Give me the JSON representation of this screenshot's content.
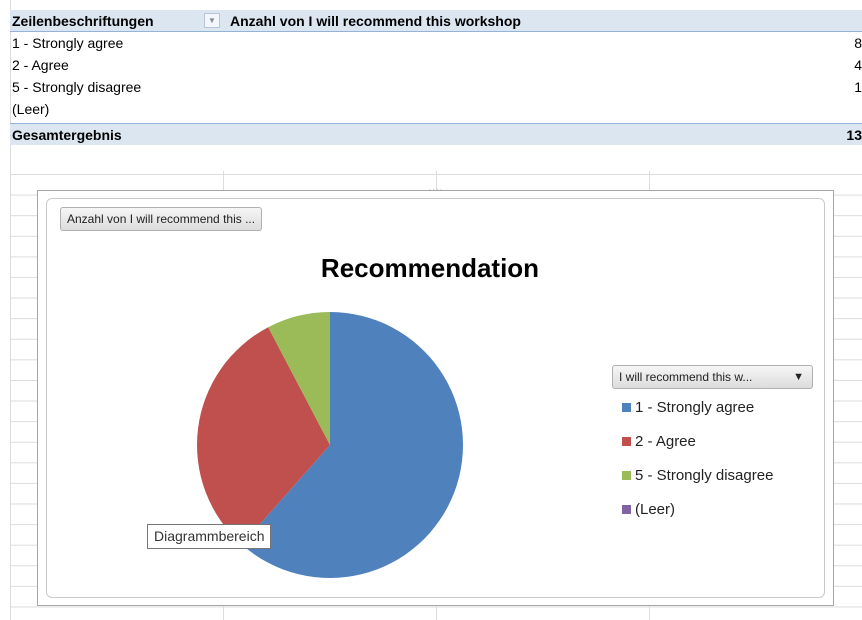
{
  "pivot": {
    "header": {
      "row_labels": "Zeilenbeschriftungen",
      "value_field": "Anzahl von I will recommend this workshop"
    },
    "rows": [
      {
        "label": "1 - Strongly agree",
        "value": "8"
      },
      {
        "label": "2 - Agree",
        "value": "4"
      },
      {
        "label": "5 - Strongly disagree",
        "value": "1"
      },
      {
        "label": "(Leer)",
        "value": ""
      }
    ],
    "total": {
      "label": "Gesamtergebnis",
      "value": "13"
    }
  },
  "chart_buttons": {
    "value_field": "Anzahl von I will recommend this ...",
    "legend_field": "I will recommend this w...",
    "legend_arrow": "▼"
  },
  "tooltip": "Diagrammbereich",
  "chart_data": {
    "type": "pie",
    "title": "Recommendation",
    "categories": [
      "1 - Strongly agree",
      "2 - Agree",
      "5 - Strongly disagree",
      "(Leer)"
    ],
    "values": [
      8,
      4,
      1,
      0
    ],
    "colors": [
      "#4f81bd",
      "#c0504d",
      "#9bbb59",
      "#8064a2"
    ],
    "legend": "right"
  }
}
